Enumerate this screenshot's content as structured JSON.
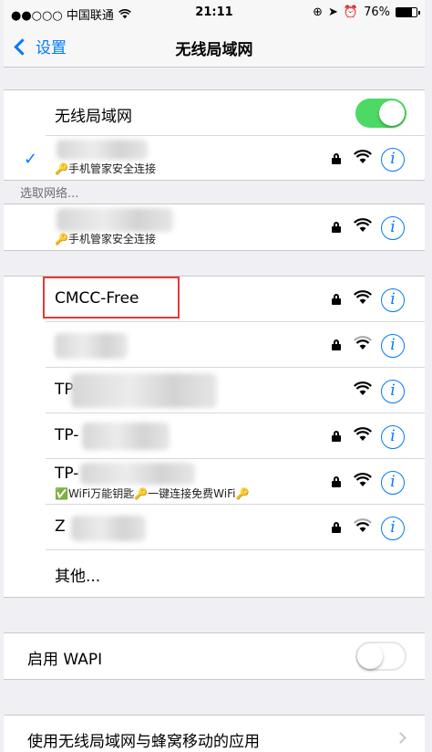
{
  "status_bar": {
    "carrier": "●●○○○ 中国联通",
    "time": "21:11",
    "battery": "76%",
    "battery_level": 0.76
  },
  "nav": {
    "back_label": "设置",
    "title": "无线局域网"
  },
  "wlan": {
    "toggle_label": "无线局域网",
    "toggle_on": true,
    "connected_sub": "🔑手机管家安全连接"
  },
  "choose_network_header": "选取网络...",
  "networks_top": [
    {
      "sub": "🔑手机管家安全连接"
    }
  ],
  "networks": [
    {
      "name": "CMCC-Free",
      "locked": true
    },
    {
      "name": "",
      "locked": true
    },
    {
      "name": "TP-",
      "locked": false
    },
    {
      "name": "TP-",
      "locked": true
    },
    {
      "name": "TP-",
      "locked": true,
      "sub": "✅WiFi万能钥匙🔑一键连接免费WiFi🔑"
    },
    {
      "name": "Z",
      "locked": true
    }
  ],
  "other_label": "其他...",
  "wapi": {
    "label": "启用 WAPI",
    "on": false
  },
  "cellular_apps_label": "使用无线局域网与蜂窝移动的应用",
  "icons": {
    "info": "i",
    "check": "✓"
  },
  "colors": {
    "accent": "#007aff",
    "toggle_on": "#4cd964",
    "highlight": "#e53935",
    "background": "#efeff4"
  }
}
